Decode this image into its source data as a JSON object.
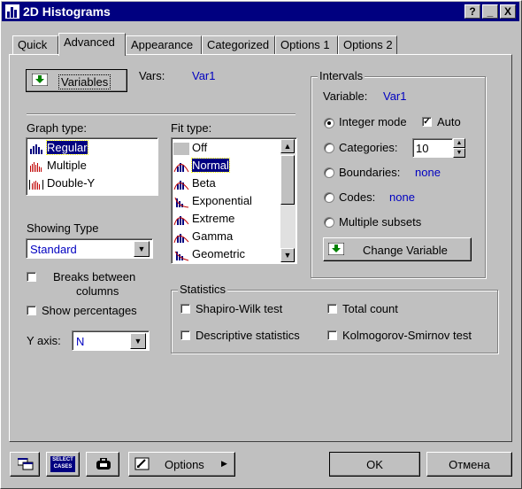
{
  "window": {
    "title": "2D Histograms",
    "help": "?",
    "minimize": "_",
    "close": "X"
  },
  "tabs": [
    {
      "label": "Quick"
    },
    {
      "label": "Advanced"
    },
    {
      "label": "Appearance"
    },
    {
      "label": "Categorized"
    },
    {
      "label": "Options 1"
    },
    {
      "label": "Options 2"
    }
  ],
  "variables_button": "Variables",
  "vars_label": "Vars:",
  "vars_value": "Var1",
  "graph_type": {
    "label": "Graph type:",
    "items": [
      "Regular",
      "Multiple",
      "Double-Y"
    ],
    "selected": "Regular"
  },
  "fit_type": {
    "label": "Fit type:",
    "items": [
      "Off",
      "Normal",
      "Beta",
      "Exponential",
      "Extreme",
      "Gamma",
      "Geometric"
    ],
    "selected": "Normal"
  },
  "showing_type": {
    "label": "Showing Type",
    "value": "Standard"
  },
  "breaks_between_columns": {
    "label_line1": "Breaks between",
    "label_line2": "columns",
    "checked": false
  },
  "show_percentages": {
    "label": "Show percentages",
    "checked": false
  },
  "y_axis": {
    "label": "Y axis:",
    "value": "N"
  },
  "intervals": {
    "label": "Intervals",
    "variable_label": "Variable:",
    "variable_value": "Var1",
    "integer_mode": "Integer mode",
    "auto": "Auto",
    "auto_checked": true,
    "categories": "Categories:",
    "categories_value": "10",
    "boundaries": "Boundaries:",
    "boundaries_value": "none",
    "codes": "Codes:",
    "codes_value": "none",
    "multiple_subsets": "Multiple subsets",
    "selected": "Integer mode",
    "change_variable": "Change Variable"
  },
  "statistics": {
    "label": "Statistics",
    "shapiro_wilk": "Shapiro-Wilk test",
    "total_count": "Total count",
    "descriptive": "Descriptive statistics",
    "ks": "Kolmogorov-Smirnov test"
  },
  "bottom": {
    "select_cases": "SELECT CASES",
    "options": "Options",
    "ok": "OK",
    "cancel": "Отмена"
  },
  "colors": {
    "title_bg": "#000080",
    "accent_text": "#0000c0",
    "face": "#c0c0c0"
  }
}
